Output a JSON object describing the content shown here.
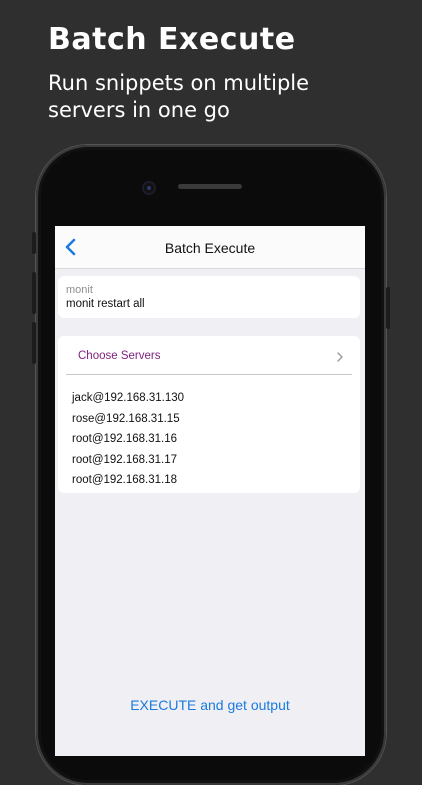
{
  "promo": {
    "title": "Batch Execute",
    "subtitle": "Run snippets on multiple servers in one go"
  },
  "navbar": {
    "back_icon": "chevron-left-icon",
    "title": "Batch Execute"
  },
  "snippet": {
    "name": "monit",
    "command": "monit restart all"
  },
  "servers": {
    "choose_label": "Choose Servers",
    "chevron_icon": "chevron-right-icon",
    "list": [
      "jack@192.168.31.130",
      "rose@192.168.31.15",
      "root@192.168.31.16",
      "root@192.168.31.17",
      "root@192.168.31.18"
    ]
  },
  "execute": {
    "label": "EXECUTE and get output"
  },
  "colors": {
    "accent_blue": "#1a7ae0",
    "choose_purple": "#7b1f7e",
    "background": "#2f2f2f",
    "screen_background": "#efeff4"
  }
}
